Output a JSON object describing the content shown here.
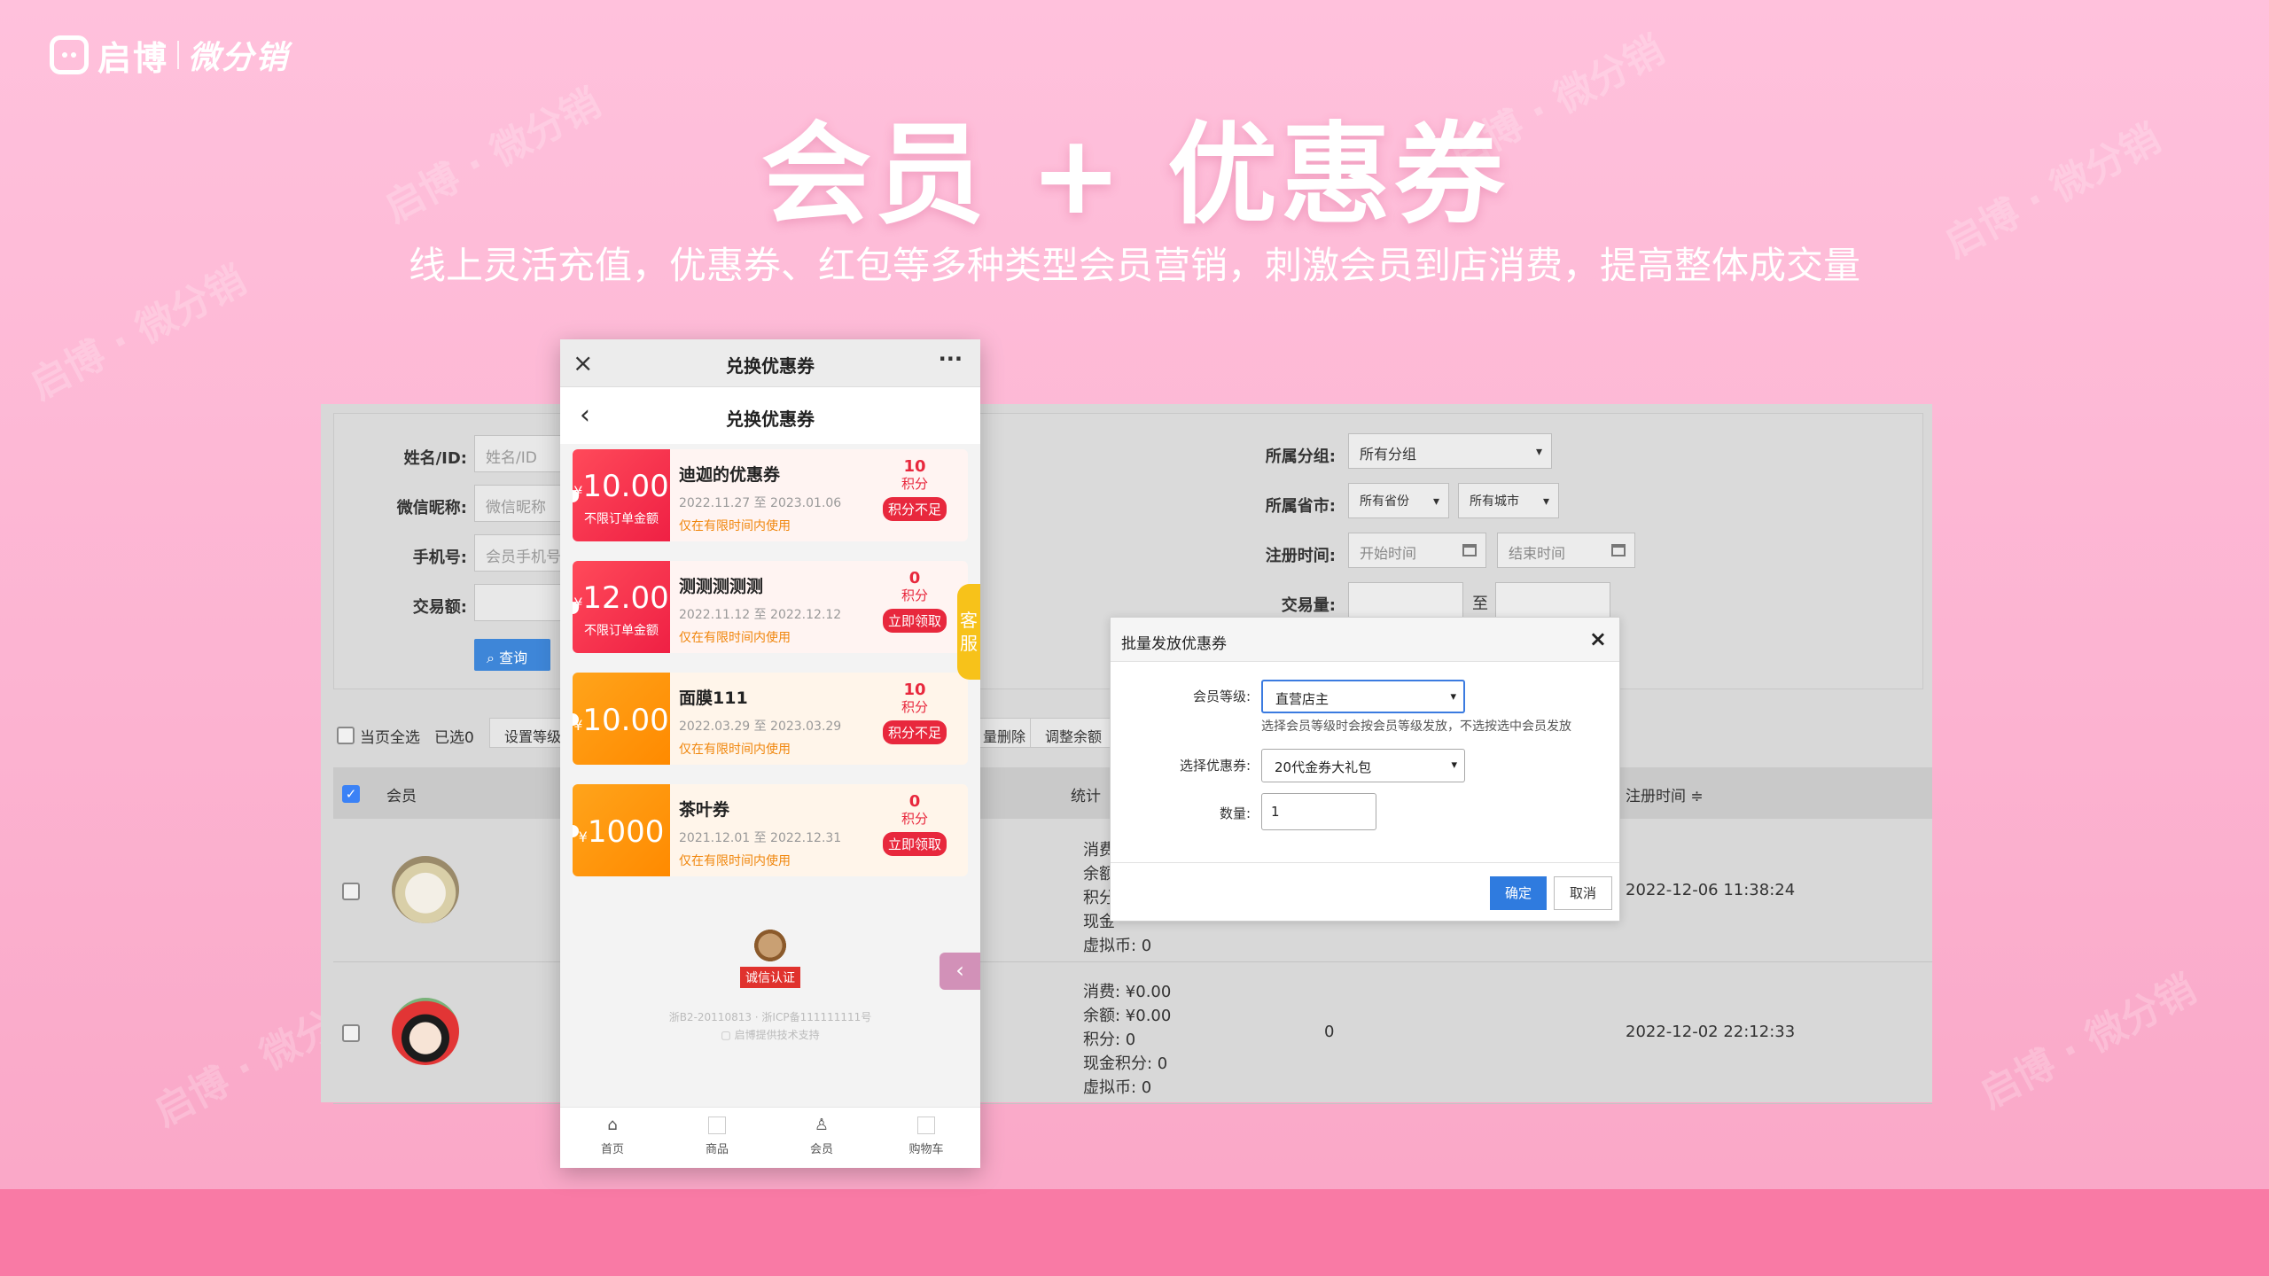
{
  "brand": {
    "name": "启博",
    "product": "微分销"
  },
  "hero": {
    "title": "会员 + 优惠券",
    "subtitle": "线上灵活充值，优惠券、红包等多种类型会员营销，刺激会员到店消费，提高整体成交量"
  },
  "admin": {
    "filters": {
      "name_label": "姓名/ID:",
      "name_placeholder": "姓名/ID",
      "wechat_label": "微信昵称:",
      "wechat_placeholder": "微信昵称",
      "phone_label": "手机号:",
      "phone_placeholder": "会员手机号",
      "amount_label": "交易额:",
      "query_button": "查询",
      "group_label": "所属分组:",
      "group_value": "所有分组",
      "region_label": "所属省市:",
      "province_value": "所有省份",
      "city_value": "所有城市",
      "reg_time_label": "注册时间:",
      "start_placeholder": "开始时间",
      "end_placeholder": "结束时间",
      "trade_count_label": "交易量:",
      "to_label": "至"
    },
    "toolbar": {
      "select_page": "当页全选",
      "selected": "已选0",
      "set_level": "设置等级",
      "batch_delete": "量删除",
      "adjust_balance": "调整余额"
    },
    "columns": {
      "member": "会员",
      "stats": "统计",
      "reg_time": "注册时间 ≑"
    },
    "rows": [
      {
        "stats": [
          "消费:",
          "余额:",
          "积分:",
          "现金",
          "虚拟币: 0"
        ],
        "reg_time": "2022-12-06 11:38:24"
      },
      {
        "stats": [
          "消费: ¥0.00",
          "余额: ¥0.00",
          "积分: 0",
          "现金积分: 0",
          "虚拟币: 0"
        ],
        "count": "0",
        "reg_time": "2022-12-02 22:12:33"
      }
    ]
  },
  "phone": {
    "window_title": "兑换优惠券",
    "page_title": "兑换优惠券",
    "coupons": [
      {
        "amount": "10.00",
        "currency": "¥",
        "sub": "不限订单金额",
        "name": "迪迦的优惠券",
        "date": "2022.11.27 至 2023.01.06",
        "limit": "仅在有限时间内使用",
        "points": "10",
        "points_label": "积分",
        "action": "积分不足",
        "style": "red"
      },
      {
        "amount": "12.00",
        "currency": "¥",
        "sub": "不限订单金额",
        "name": "测测测测测",
        "date": "2022.11.12 至 2022.12.12",
        "limit": "仅在有限时间内使用",
        "points": "0",
        "points_label": "积分",
        "action": "立即领取",
        "style": "red"
      },
      {
        "amount": "10.00",
        "currency": "¥",
        "sub": "",
        "name": "面膜111",
        "date": "2022.03.29 至 2023.03.29",
        "limit": "仅在有限时间内使用",
        "points": "10",
        "points_label": "积分",
        "action": "积分不足",
        "style": "orange"
      },
      {
        "amount": "1000",
        "currency": "¥",
        "sub": "",
        "name": "茶叶券",
        "date": "2021.12.01 至 2022.12.31",
        "limit": "仅在有限时间内使用",
        "points": "0",
        "points_label": "积分",
        "action": "立即领取",
        "style": "orange"
      }
    ],
    "service_label": "客服",
    "cert_label": "诚信认证",
    "icp": "浙B2-20110813 · 浙ICP备111111111号",
    "support": "启博提供技术支持",
    "tabs": [
      "首页",
      "商品",
      "会员",
      "购物车"
    ]
  },
  "dialog": {
    "title": "批量发放优惠券",
    "level_label": "会员等级:",
    "level_value": "直营店主",
    "hint": "选择会员等级时会按会员等级发放，不选按选中会员发放",
    "coupon_label": "选择优惠券:",
    "coupon_value": "20代金券大礼包",
    "qty_label": "数量:",
    "qty_value": "1",
    "ok": "确定",
    "cancel": "取消"
  },
  "colors": {
    "accent_pink": "#f97aa5",
    "primary_blue": "#2f7bdf",
    "coupon_red": "#ef2044",
    "coupon_orange": "#ff8a00"
  }
}
